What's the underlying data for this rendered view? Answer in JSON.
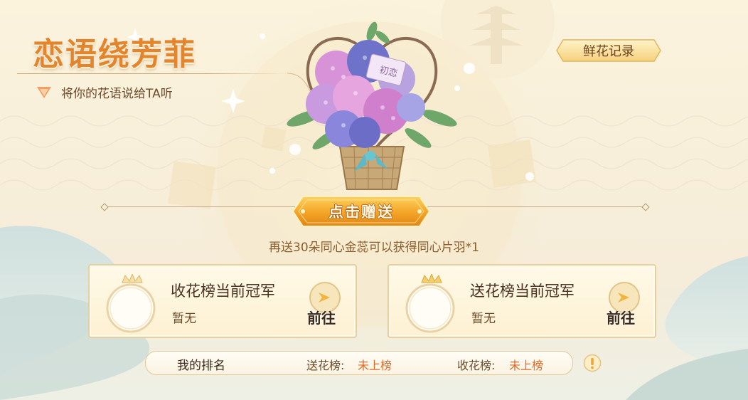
{
  "header": {
    "title": "恋语绕芳菲",
    "subtitle": "将你的花语说给TA听",
    "record_button": "鲜花记录"
  },
  "gift": {
    "tag_text": "初恋",
    "button_label": "点击赠送",
    "hint": "再送30朵同心金蕊可以获得同心片羽*1"
  },
  "champions": [
    {
      "title": "收花榜当前冠军",
      "value": "暂无",
      "go_label": "前往"
    },
    {
      "title": "送花榜当前冠军",
      "value": "暂无",
      "go_label": "前往"
    }
  ],
  "my_rank": {
    "label": "我的排名",
    "send_key": "送花榜:",
    "send_value": "未上榜",
    "receive_key": "收花榜:",
    "receive_value": "未上榜"
  },
  "icons": {
    "triangle": "triangle-down-icon",
    "go": "arrow-right-icon",
    "info": "exclamation-icon",
    "crown": "crown-icon"
  },
  "colors": {
    "title": "#e2852c",
    "accent_gold": "#f0b23c",
    "rank_value": "#e06a2a"
  }
}
